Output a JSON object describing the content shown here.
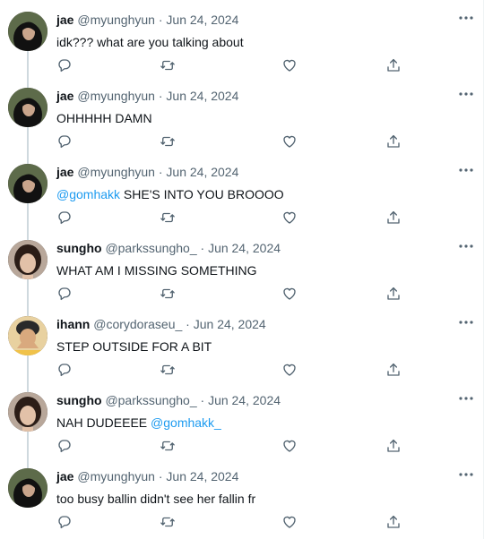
{
  "tweets": [
    {
      "name": "jae",
      "handle": "@myunghyun",
      "date": "Jun 24, 2024",
      "mention": "",
      "text": "idk??? what are you talking about"
    },
    {
      "name": "jae",
      "handle": "@myunghyun",
      "date": "Jun 24, 2024",
      "mention": "",
      "text": "OHHHHH DAMN"
    },
    {
      "name": "jae",
      "handle": "@myunghyun",
      "date": "Jun 24, 2024",
      "mention": "@gomhakk",
      "text": "SHE'S INTO YOU BROOOO"
    },
    {
      "name": "sungho",
      "handle": "@parkssungho_",
      "date": "Jun 24, 2024",
      "mention": "",
      "text": "WHAT AM I MISSING SOMETHING"
    },
    {
      "name": "ihann",
      "handle": "@corydoraseu_",
      "date": "Jun 24, 2024",
      "mention": "",
      "text": "STEP OUTSIDE FOR A BIT"
    },
    {
      "name": "sungho",
      "handle": "@parkssungho_",
      "date": "Jun 24, 2024",
      "mention": "@gomhakk_",
      "text": "NAH DUDEEEE"
    },
    {
      "name": "jae",
      "handle": "@myunghyun",
      "date": "Jun 24, 2024",
      "mention": "",
      "text": "too busy ballin didn't see her fallin fr"
    }
  ],
  "separator": " · ",
  "icons": {
    "more": "more-horizontal-icon",
    "reply": "reply-icon",
    "retweet": "retweet-icon",
    "like": "heart-icon",
    "share": "share-icon"
  },
  "colors": {
    "text": "#0f1419",
    "secondary": "#536471",
    "mention": "#1d9bf0",
    "thread_line": "#cfd9de"
  }
}
